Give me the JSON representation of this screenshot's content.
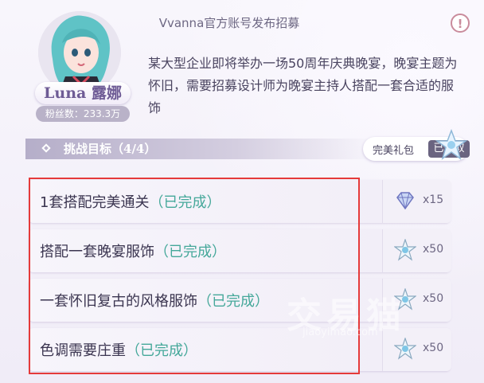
{
  "header": {
    "title": "Vvanna官方账号发布招募"
  },
  "profile": {
    "name": "Luna 露娜",
    "fans": "粉丝数：233.3万"
  },
  "description": "某大型企业即将举办一场50周年庆典晚宴，晚宴主题为怀旧，需要招募设计师为晚宴主持人搭配一套合适的服饰",
  "challenge": {
    "title": "挑战目标（4/4）",
    "gift_label": "完美礼包",
    "claimed_label": "已领取"
  },
  "tasks": [
    {
      "text": "1套搭配完美通关",
      "status": "（已完成）",
      "reward_icon": "diamond-icon",
      "reward_count": "x15"
    },
    {
      "text": "搭配一套晚宴服饰",
      "status": "（已完成）",
      "reward_icon": "star-crystal-icon",
      "reward_count": "x50"
    },
    {
      "text": "一套怀旧复古的风格服饰",
      "status": "（已完成）",
      "reward_icon": "star-crystal-icon",
      "reward_count": "x50"
    },
    {
      "text": "色调需要庄重",
      "status": "（已完成）",
      "reward_icon": "star-crystal-icon",
      "reward_count": "x50"
    }
  ],
  "watermark": {
    "text": "交易猫",
    "url": "jiaoyimao.com"
  },
  "colors": {
    "done": "#45a89a",
    "highlight": "#e53a3a",
    "claimed_bg": "#6a6480"
  }
}
